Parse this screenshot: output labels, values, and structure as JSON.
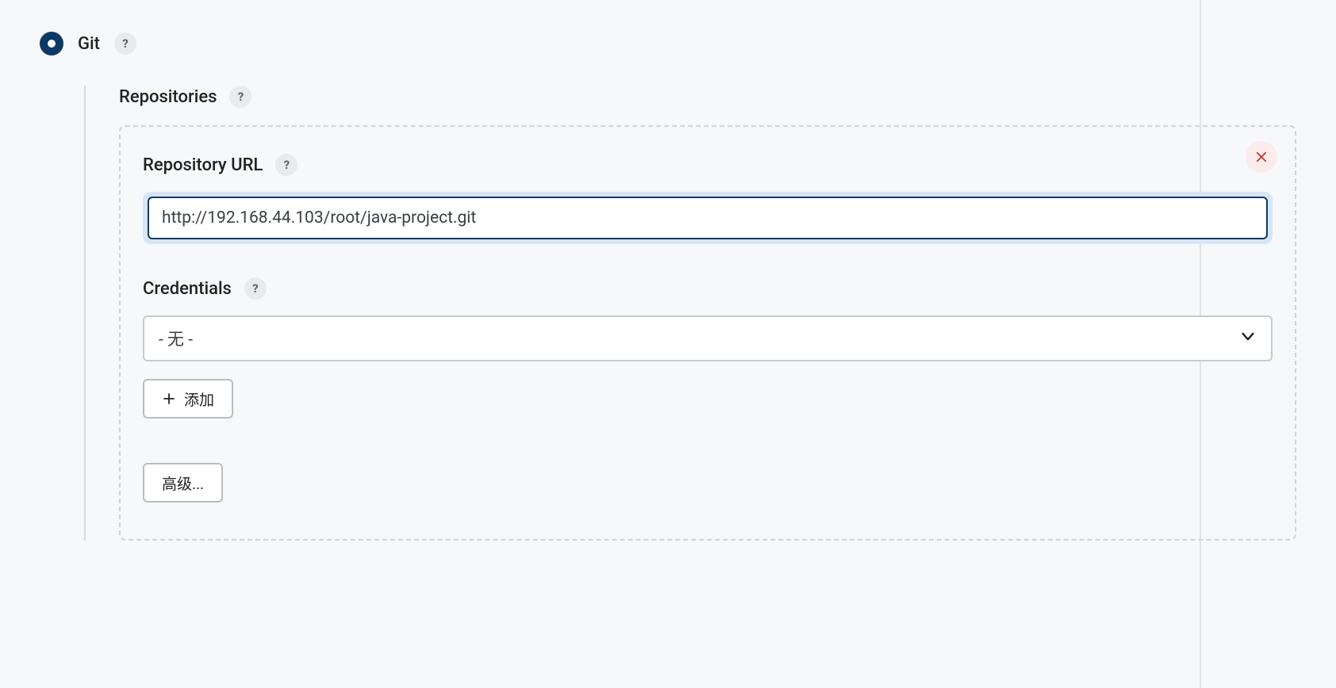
{
  "git_section": {
    "label": "Git",
    "help_glyph": "?"
  },
  "repositories": {
    "label": "Repositories",
    "help_glyph": "?"
  },
  "repo_url": {
    "label": "Repository URL",
    "help_glyph": "?",
    "value": "http://192.168.44.103/root/java-project.git"
  },
  "credentials": {
    "label": "Credentials",
    "help_glyph": "?",
    "selected": "- 无 -"
  },
  "buttons": {
    "add": "添加",
    "advanced": "高级..."
  }
}
